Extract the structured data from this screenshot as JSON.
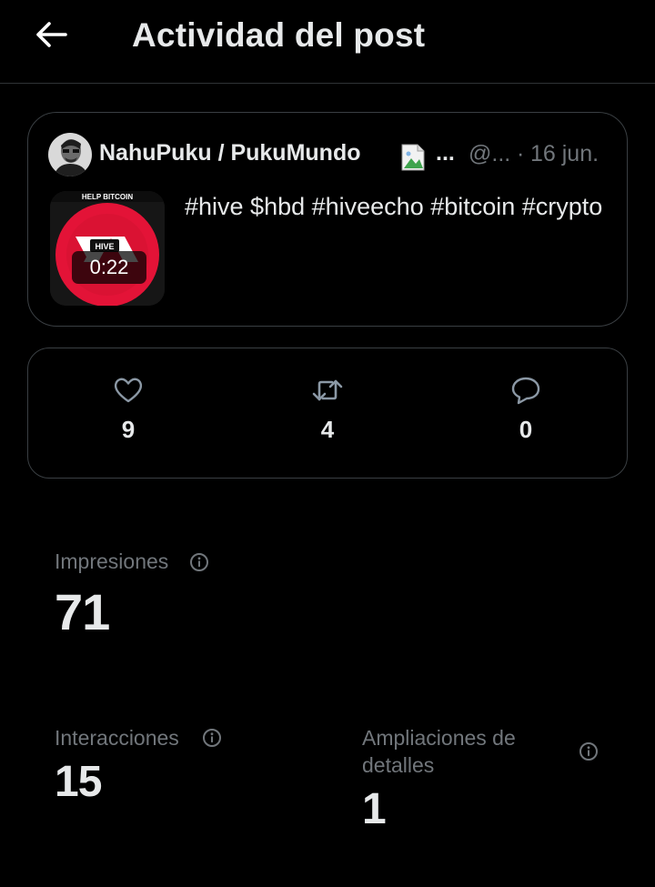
{
  "header": {
    "title": "Actividad del post"
  },
  "post": {
    "author_name": "NahuPuku / PukuMundo",
    "name_ellipsis": "...",
    "handle": "@...",
    "separator": "·",
    "date": "16 jun.",
    "text": "#hive $hbd #hiveecho #bitcoin #crypto",
    "media": {
      "duration": "0:22",
      "banner_text": "HELP BITCOIN",
      "logo_text": "HIVE",
      "accent_color": "#e31337"
    }
  },
  "engagement": {
    "likes": "9",
    "reposts": "4",
    "replies": "0"
  },
  "metrics": {
    "impressions_label": "Impresiones",
    "impressions_value": "71",
    "interactions_label": "Interacciones",
    "interactions_value": "15",
    "detail_expands_label_line1": "Ampliaciones de",
    "detail_expands_label_line2": "detalles",
    "detail_expands_value": "1"
  },
  "colors": {
    "background": "#000000",
    "text_primary": "#e7e9ea",
    "text_secondary": "#71767b",
    "border": "#3a3f43"
  }
}
